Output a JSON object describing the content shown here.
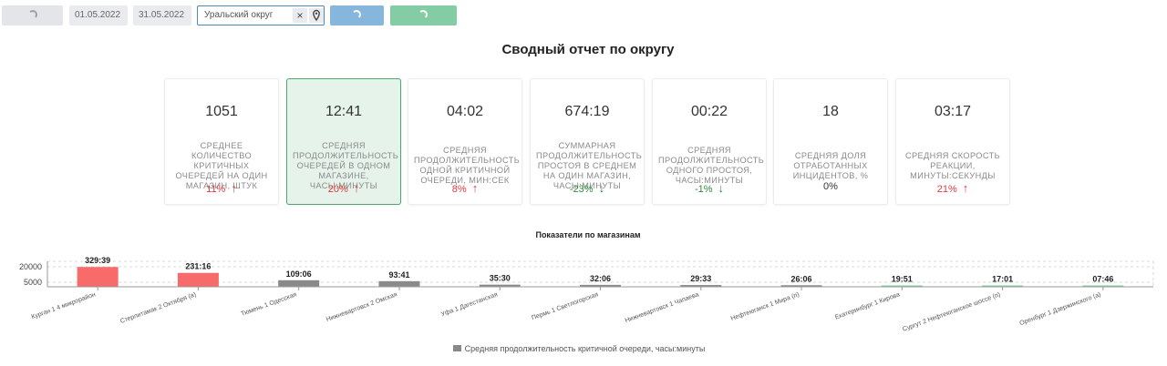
{
  "toolbar": {
    "date_from": "01.05.2022",
    "date_to": "31.05.2022",
    "region_value": "Уральский округ",
    "clear_glyph": "×"
  },
  "title": "Сводный отчет по округу",
  "cards": [
    {
      "value": "1051",
      "label": "Среднее количество критичных очередей на один магазин, штук",
      "delta": "11%",
      "trend": "up",
      "selected": false
    },
    {
      "value": "12:41",
      "label": "Средняя продолжительность очередей в одном магазине, часы:минуты",
      "delta": "20%",
      "trend": "up",
      "selected": true
    },
    {
      "value": "04:02",
      "label": "Средняя продолжительность одной критичной очереди, мин:сек",
      "delta": "8%",
      "trend": "up",
      "selected": false
    },
    {
      "value": "674:19",
      "label": "Суммарная продолжительность простоя в среднем на один магазин, часы:минуты",
      "delta": "-23%",
      "trend": "down",
      "selected": false
    },
    {
      "value": "00:22",
      "label": "Средняя продолжительность одного простоя, часы:минуты",
      "delta": "-1%",
      "trend": "down",
      "selected": false
    },
    {
      "value": "18",
      "label": "Средняя доля отработанных инцидентов, %",
      "delta": "0%",
      "trend": "none",
      "selected": false
    },
    {
      "value": "03:17",
      "label": "Средняя скорость реакции, минуты:секунды",
      "delta": "21%",
      "trend": "up",
      "selected": false
    }
  ],
  "chart_data": {
    "type": "bar",
    "title": "Показатели по магазинам",
    "categories": [
      "Курган 1 4 микрорайон",
      "Стерлитамак 2 Октября (а)",
      "Тюмень 1 Одесская",
      "Нижневартовск 2 Омская",
      "Уфа 1 Дагестанская",
      "Пермь 1 Светлогорская",
      "Нижневартовск 1 Чапаева",
      "Нефтеюганск 1 Мира (п)",
      "Екатеринбург 1 Кирова",
      "Сургут 2 Нефтеюганское шоссе (п)",
      "Оренбург 1 Дзержинского (а)"
    ],
    "values": [
      19779,
      13876,
      6546,
      5621,
      2130,
      1926,
      1773,
      1566,
      1191,
      1021,
      466
    ],
    "data_labels": [
      "329:39",
      "231:16",
      "109:06",
      "93:41",
      "35:30",
      "32:06",
      "29:33",
      "26:06",
      "19:51",
      "17:01",
      "07:46"
    ],
    "bar_colors": [
      "#f86b6b",
      "#f86b6b",
      "#8a8a8a",
      "#8a8a8a",
      "#8a8a8a",
      "#8a8a8a",
      "#8a8a8a",
      "#8a8a8a",
      "#7fd396",
      "#7fd396",
      "#7fd396"
    ],
    "yticks": [
      "20000",
      "5000"
    ],
    "ylim": [
      0,
      21000
    ],
    "legend": "Средняя продолжительность критичной очереди, часы:минуты",
    "legend_color": "#888888"
  }
}
